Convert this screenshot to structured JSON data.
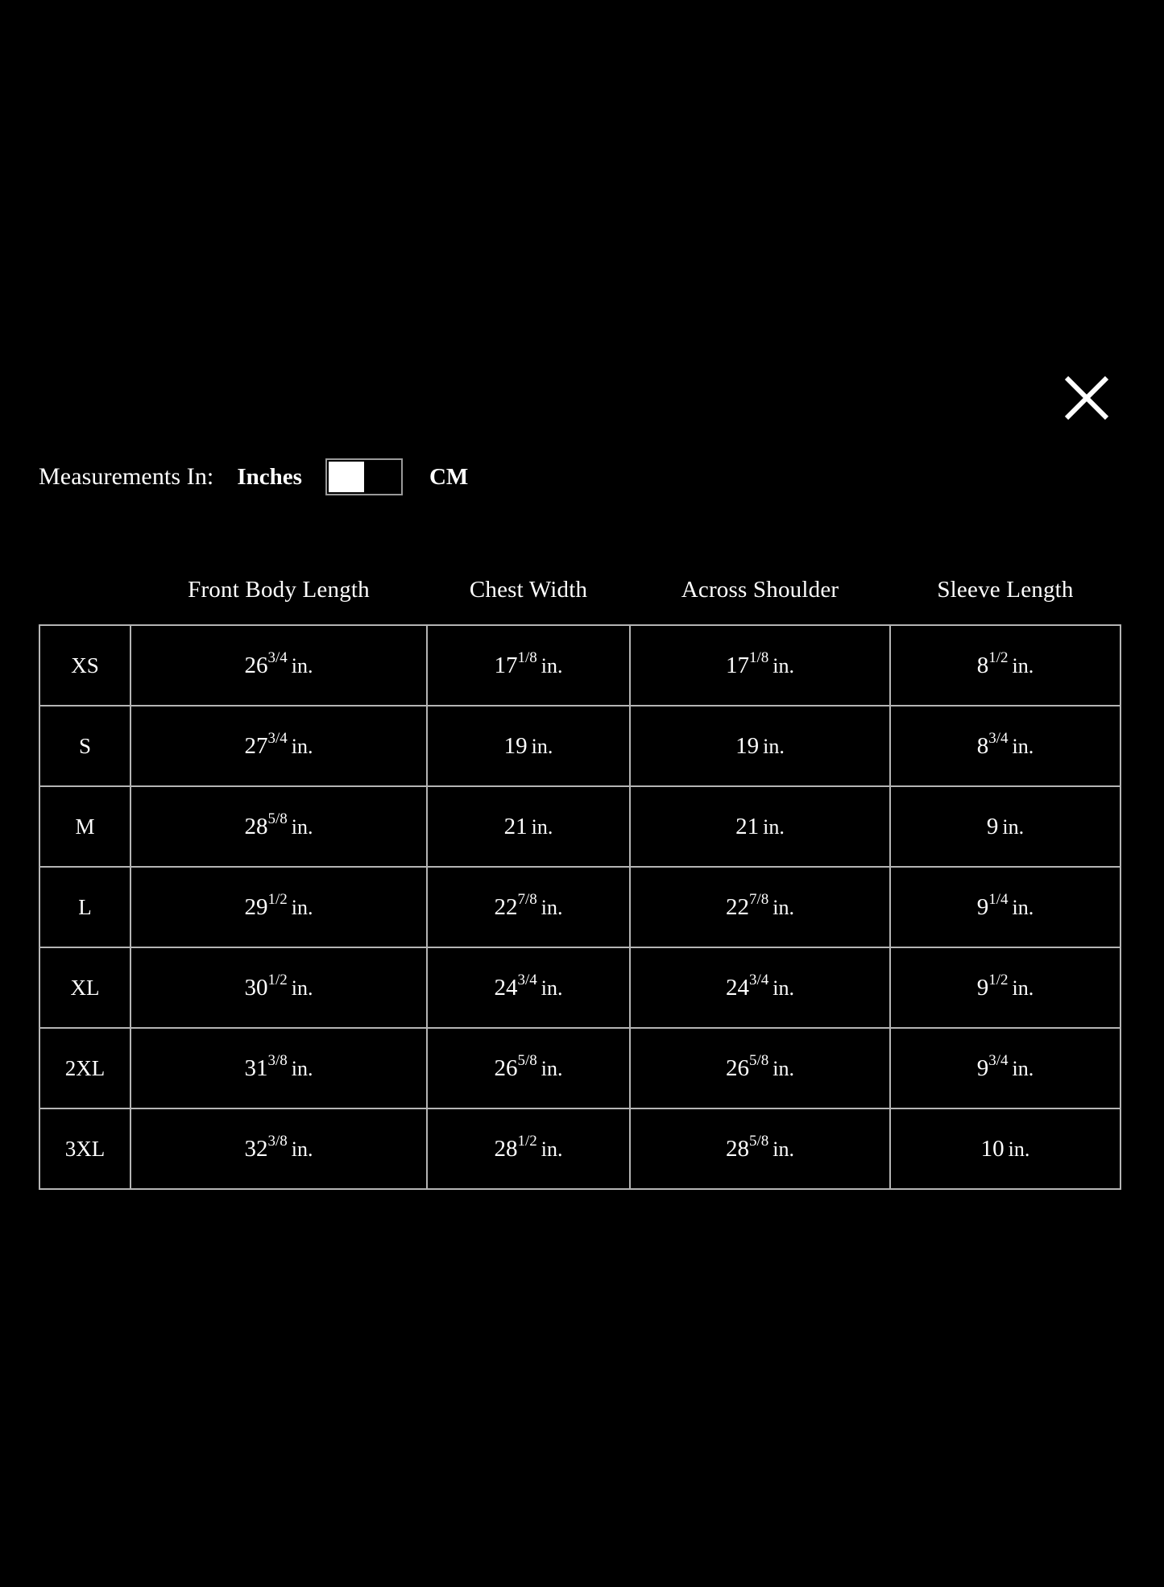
{
  "modal": {
    "close_icon": "close-x-icon",
    "background_color": "#000000",
    "text_color": "#ffffff",
    "border_color": "#b5b5b5"
  },
  "units": {
    "label": "Measurements In:",
    "option_left": "Inches",
    "option_right": "CM",
    "selected": "Inches",
    "toggle_state": "left"
  },
  "table": {
    "headers": [
      "",
      "Front Body Length",
      "Chest Width",
      "Across Shoulder",
      "Sleeve Length"
    ],
    "unit_suffix": "in.",
    "rows": [
      {
        "size": "XS",
        "front_body_length": {
          "whole": "26",
          "frac": "3/4",
          "unit": "in."
        },
        "chest_width": {
          "whole": "17",
          "frac": "1/8",
          "unit": "in."
        },
        "across_shoulder": {
          "whole": "17",
          "frac": "1/8",
          "unit": "in."
        },
        "sleeve_length": {
          "whole": "8",
          "frac": "1/2",
          "unit": "in."
        }
      },
      {
        "size": "S",
        "front_body_length": {
          "whole": "27",
          "frac": "3/4",
          "unit": "in."
        },
        "chest_width": {
          "whole": "19",
          "frac": "",
          "unit": "in."
        },
        "across_shoulder": {
          "whole": "19",
          "frac": "",
          "unit": "in."
        },
        "sleeve_length": {
          "whole": "8",
          "frac": "3/4",
          "unit": "in."
        }
      },
      {
        "size": "M",
        "front_body_length": {
          "whole": "28",
          "frac": "5/8",
          "unit": "in."
        },
        "chest_width": {
          "whole": "21",
          "frac": "",
          "unit": "in."
        },
        "across_shoulder": {
          "whole": "21",
          "frac": "",
          "unit": "in."
        },
        "sleeve_length": {
          "whole": "9",
          "frac": "",
          "unit": "in."
        }
      },
      {
        "size": "L",
        "front_body_length": {
          "whole": "29",
          "frac": "1/2",
          "unit": "in."
        },
        "chest_width": {
          "whole": "22",
          "frac": "7/8",
          "unit": "in."
        },
        "across_shoulder": {
          "whole": "22",
          "frac": "7/8",
          "unit": "in."
        },
        "sleeve_length": {
          "whole": "9",
          "frac": "1/4",
          "unit": "in."
        }
      },
      {
        "size": "XL",
        "front_body_length": {
          "whole": "30",
          "frac": "1/2",
          "unit": "in."
        },
        "chest_width": {
          "whole": "24",
          "frac": "3/4",
          "unit": "in."
        },
        "across_shoulder": {
          "whole": "24",
          "frac": "3/4",
          "unit": "in."
        },
        "sleeve_length": {
          "whole": "9",
          "frac": "1/2",
          "unit": "in."
        }
      },
      {
        "size": "2XL",
        "front_body_length": {
          "whole": "31",
          "frac": "3/8",
          "unit": "in."
        },
        "chest_width": {
          "whole": "26",
          "frac": "5/8",
          "unit": "in."
        },
        "across_shoulder": {
          "whole": "26",
          "frac": "5/8",
          "unit": "in."
        },
        "sleeve_length": {
          "whole": "9",
          "frac": "3/4",
          "unit": "in."
        }
      },
      {
        "size": "3XL",
        "front_body_length": {
          "whole": "32",
          "frac": "3/8",
          "unit": "in."
        },
        "chest_width": {
          "whole": "28",
          "frac": "1/2",
          "unit": "in."
        },
        "across_shoulder": {
          "whole": "28",
          "frac": "5/8",
          "unit": "in."
        },
        "sleeve_length": {
          "whole": "10",
          "frac": "",
          "unit": "in."
        }
      }
    ]
  }
}
